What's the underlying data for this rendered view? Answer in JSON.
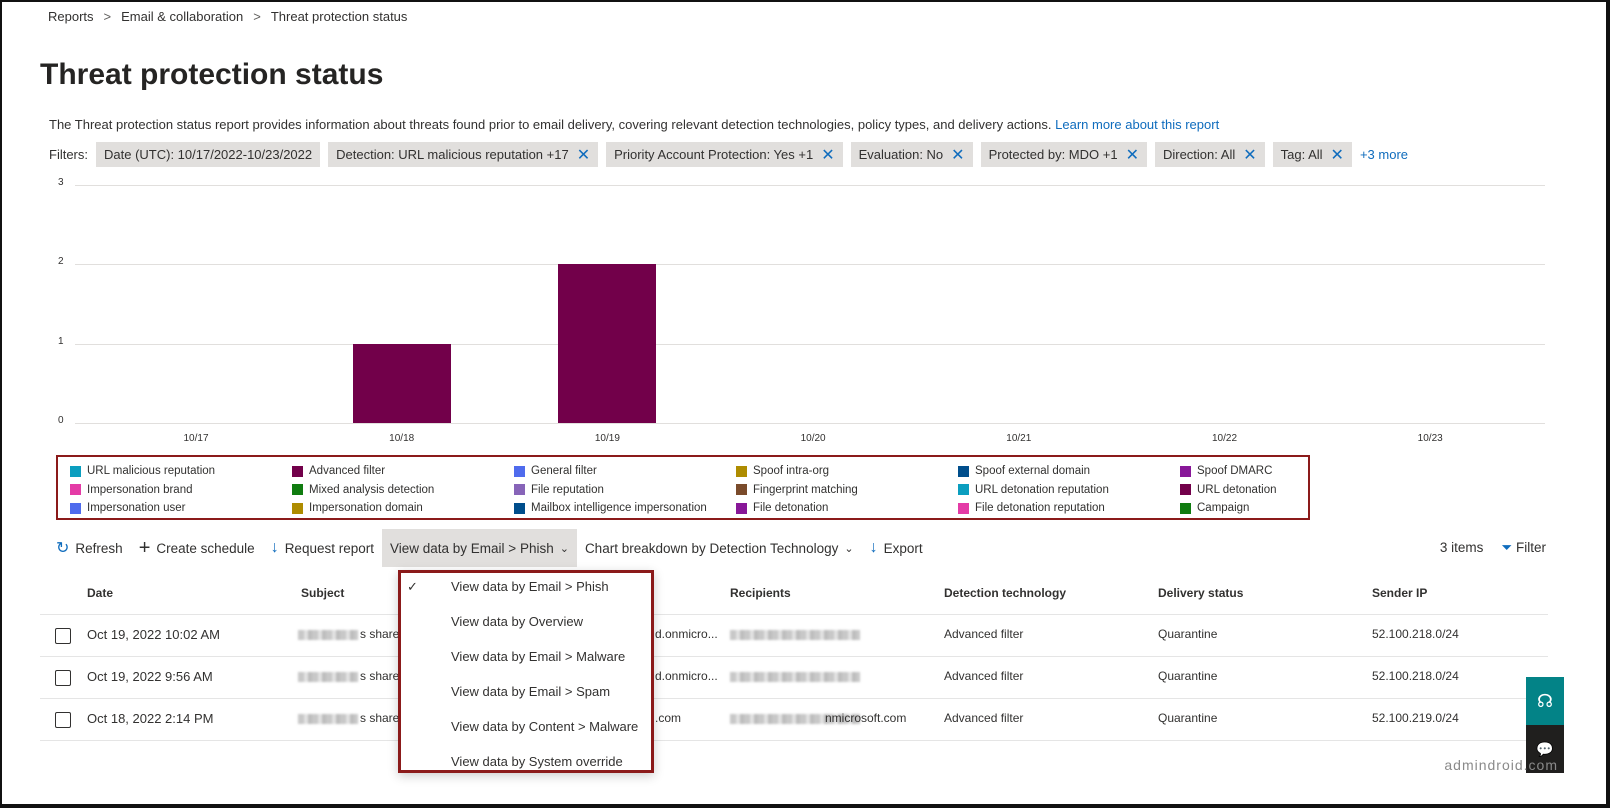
{
  "breadcrumb": [
    "Reports",
    "Email & collaboration",
    "Threat protection status"
  ],
  "title": "Threat protection status",
  "description": "The Threat protection status report provides information about threats found prior to email delivery, covering relevant detection technologies, policy types, and delivery actions.",
  "learn_more": "Learn more about this report",
  "filters_label": "Filters:",
  "filters": [
    "Date (UTC): 10/17/2022-10/23/2022",
    "Detection: URL malicious reputation +17",
    "Priority Account Protection: Yes +1",
    "Evaluation: No",
    "Protected by: MDO +1",
    "Direction: All",
    "Tag: All"
  ],
  "more_filters": "+3 more",
  "chart_data": {
    "type": "bar",
    "categories": [
      "10/17",
      "10/18",
      "10/19",
      "10/20",
      "10/21",
      "10/22",
      "10/23"
    ],
    "series": [
      {
        "name": "Advanced filter",
        "color": "#72004a",
        "values": [
          0,
          1,
          2,
          0,
          0,
          0,
          0
        ]
      }
    ],
    "ylim": [
      0,
      3
    ],
    "yticks": [
      "0",
      "1",
      "2",
      "3"
    ],
    "grid": true,
    "legend_position": "bottom"
  },
  "legend": [
    {
      "label": "URL malicious reputation",
      "color": "#0b9ebf"
    },
    {
      "label": "Advanced filter",
      "color": "#72004a"
    },
    {
      "label": "General filter",
      "color": "#4f6bed"
    },
    {
      "label": "Spoof intra-org",
      "color": "#ae8c00"
    },
    {
      "label": "Spoof external domain",
      "color": "#004e8c"
    },
    {
      "label": "Spoof DMARC",
      "color": "#881798"
    },
    {
      "label": "Impersonation brand",
      "color": "#e43ba6"
    },
    {
      "label": "Mixed analysis detection",
      "color": "#107c10"
    },
    {
      "label": "File reputation",
      "color": "#8764b8"
    },
    {
      "label": "Fingerprint matching",
      "color": "#7a4b2b"
    },
    {
      "label": "URL detonation reputation",
      "color": "#0b9ebf"
    },
    {
      "label": "URL detonation",
      "color": "#72004a"
    },
    {
      "label": "Impersonation user",
      "color": "#4f6bed"
    },
    {
      "label": "Impersonation domain",
      "color": "#ae8c00"
    },
    {
      "label": "Mailbox intelligence impersonation",
      "color": "#004e8c"
    },
    {
      "label": "File detonation",
      "color": "#881798"
    },
    {
      "label": "File detonation reputation",
      "color": "#e43ba6"
    },
    {
      "label": "Campaign",
      "color": "#107c10"
    }
  ],
  "toolbar": {
    "refresh": "Refresh",
    "create_schedule": "Create schedule",
    "request_report": "Request report",
    "view_data": "View data by Email > Phish",
    "chart_breakdown": "Chart breakdown by Detection Technology",
    "export": "Export",
    "items": "3 items",
    "filter": "Filter"
  },
  "view_menu": [
    "View data by Email > Phish",
    "View data by Overview",
    "View data by Email > Malware",
    "View data by Email > Spam",
    "View data by Content > Malware",
    "View data by System override"
  ],
  "table": {
    "headers": [
      "Date",
      "Subject",
      "Recipients",
      "Detection technology",
      "Delivery status",
      "Sender IP"
    ],
    "rows": [
      {
        "date": "Oct 19, 2022 10:02 AM",
        "subject": "s share",
        "sender": "d.onmicro...",
        "recipients": "",
        "detection": "Advanced filter",
        "delivery": "Quarantine",
        "ip": "52.100.218.0/24"
      },
      {
        "date": "Oct 19, 2022 9:56 AM",
        "subject": "s share",
        "sender": "d.onmicro...",
        "recipients": "",
        "detection": "Advanced filter",
        "delivery": "Quarantine",
        "ip": "52.100.218.0/24"
      },
      {
        "date": "Oct 18, 2022 2:14 PM",
        "subject": "s shared",
        "sender": ".com",
        "recipients": "nmicrosoft.com",
        "detection": "Advanced filter",
        "delivery": "Quarantine",
        "ip": "52.100.219.0/24"
      }
    ]
  },
  "watermark": "admindroid.com"
}
